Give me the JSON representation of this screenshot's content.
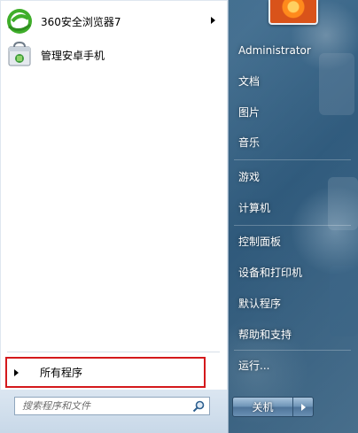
{
  "pinned_apps": [
    {
      "label": "360安全浏览器7",
      "icon": "360-browser-icon",
      "has_submenu": true
    },
    {
      "label": "管理安卓手机",
      "icon": "android-manager-icon",
      "has_submenu": false
    }
  ],
  "all_programs": {
    "label": "所有程序",
    "highlight_color": "#d4191c"
  },
  "search": {
    "placeholder": "搜索程序和文件",
    "icon": "search-icon"
  },
  "user": {
    "name": "Administrator",
    "picture": "user-avatar"
  },
  "right_items": [
    "文档",
    "图片",
    "音乐",
    "游戏",
    "计算机",
    "控制面板",
    "设备和打印机",
    "默认程序",
    "帮助和支持",
    "运行..."
  ],
  "shutdown": {
    "label": "关机",
    "options_icon": "chevron-right-icon"
  },
  "colors": {
    "accent": "#d4191c",
    "menu_left_bg": "#ffffff",
    "shutdown_blue": "#6b92b5"
  }
}
